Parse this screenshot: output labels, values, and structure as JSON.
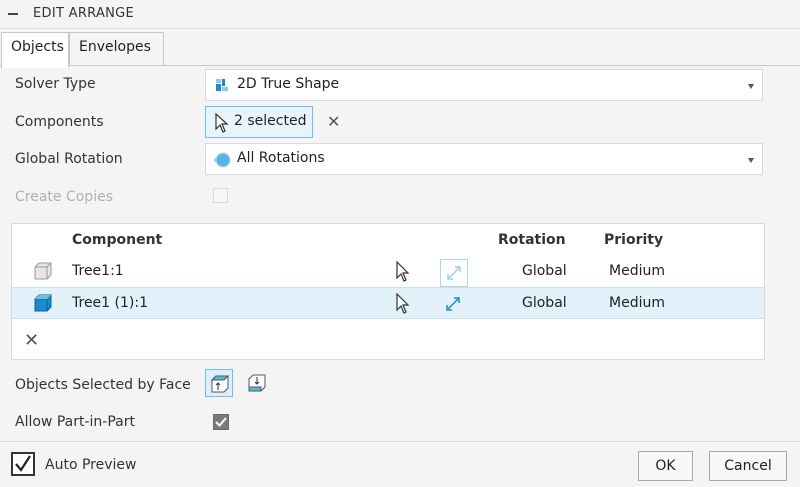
{
  "header": {
    "title": "EDIT ARRANGE"
  },
  "tabs": [
    {
      "label": "Objects",
      "active": true
    },
    {
      "label": "Envelopes",
      "active": false
    }
  ],
  "solver_type": {
    "label": "Solver Type",
    "value": "2D True Shape",
    "icon": "solver-shape-icon"
  },
  "components": {
    "label": "Components",
    "selection": "2 selected",
    "icon": "pointer-icon"
  },
  "global_rotation": {
    "label": "Global Rotation",
    "value": "All Rotations",
    "icon": "rotation-icon"
  },
  "create_copies": {
    "label": "Create Copies",
    "checked": false,
    "disabled": true
  },
  "table": {
    "headers": {
      "component": "Component",
      "rotation": "Rotation",
      "priority": "Priority"
    },
    "rows": [
      {
        "name": "Tree1:1",
        "rotation": "Global",
        "priority": "Medium",
        "selected": false
      },
      {
        "name": "Tree1 (1):1",
        "rotation": "Global",
        "priority": "Medium",
        "selected": true
      }
    ]
  },
  "objects_selected_by_face": {
    "label": "Objects Selected by Face"
  },
  "allow_part_in_part": {
    "label": "Allow Part-in-Part",
    "checked": true
  },
  "footer": {
    "auto_preview": {
      "label": "Auto Preview",
      "checked": true
    },
    "ok_label": "OK",
    "cancel_label": "Cancel"
  },
  "colors": {
    "accent": "#1a8ccc",
    "selection_bg": "#e2f1fa",
    "selection_border": "#74bde6"
  }
}
